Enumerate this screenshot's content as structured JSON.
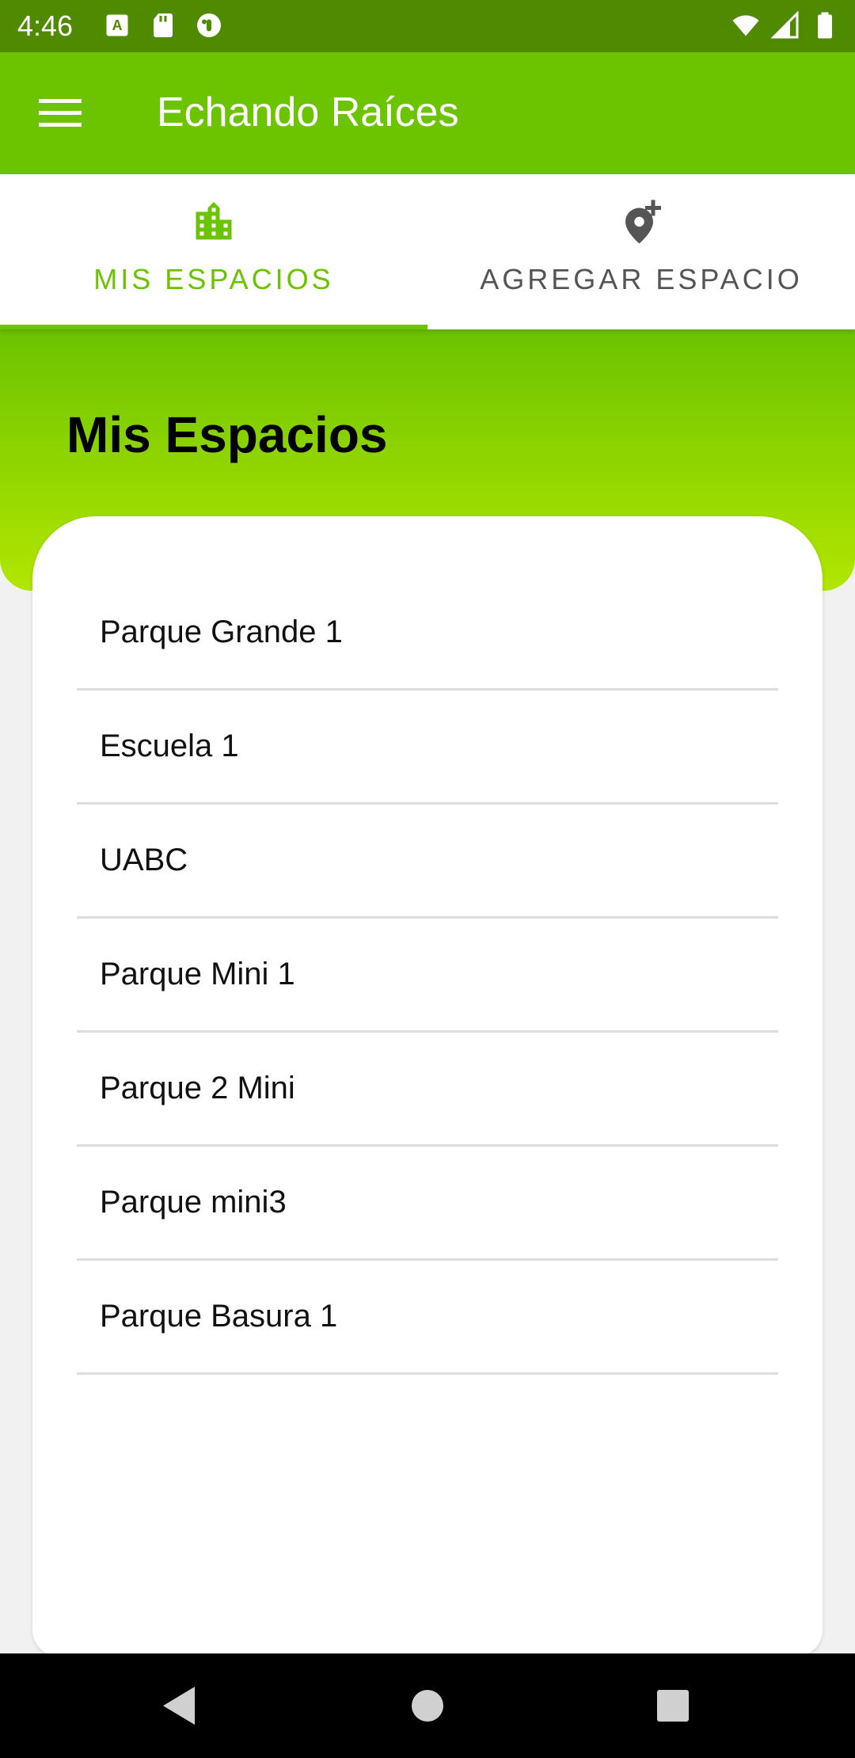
{
  "status_bar": {
    "time": "4:46",
    "left_icons": [
      "keyboard-a-icon",
      "sd-card-icon",
      "app-notification-icon"
    ],
    "right_icons": [
      "wifi-icon",
      "signal-icon",
      "battery-icon"
    ]
  },
  "app_bar": {
    "title": "Echando Raíces",
    "menu_icon": "hamburger-menu-icon"
  },
  "tabs": [
    {
      "label": "MIS ESPACIOS",
      "icon": "city-icon",
      "active": true
    },
    {
      "label": "AGREGAR ESPACIO",
      "icon": "add-location-icon",
      "active": false
    }
  ],
  "page": {
    "title": "Mis Espacios"
  },
  "spaces": [
    {
      "label": "Parque Grande 1"
    },
    {
      "label": "Escuela 1"
    },
    {
      "label": "UABC"
    },
    {
      "label": "Parque Mini 1"
    },
    {
      "label": "Parque 2 Mini"
    },
    {
      "label": "Parque mini3"
    },
    {
      "label": "Parque Basura 1"
    }
  ],
  "nav_bar": {
    "buttons": [
      "back-icon",
      "home-icon",
      "recents-icon"
    ]
  },
  "colors": {
    "primary": "#6cc300",
    "status_bar": "#4f8a00",
    "gradient_end": "#b2e600",
    "inactive_tab": "#555555"
  }
}
